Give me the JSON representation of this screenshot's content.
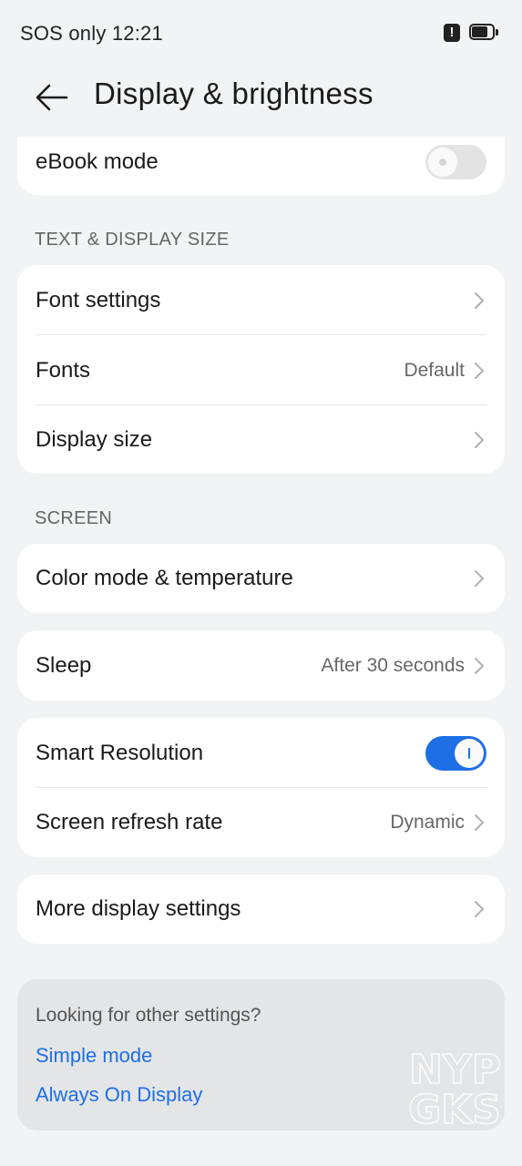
{
  "status_bar": {
    "text": "SOS only 12:21",
    "alert_symbol": "!",
    "icons": [
      "alert-icon",
      "battery-icon"
    ]
  },
  "header": {
    "back_icon": "arrow-left-icon",
    "title": "Display & brightness"
  },
  "top_card": {
    "ebook_label": "eBook mode",
    "ebook_toggle_on": false
  },
  "text_display_section": {
    "title": "TEXT & DISPLAY SIZE",
    "items": [
      {
        "label": "Font settings",
        "value": ""
      },
      {
        "label": "Fonts",
        "value": "Default"
      },
      {
        "label": "Display size",
        "value": ""
      }
    ]
  },
  "screen_section": {
    "title": "SCREEN",
    "color_mode_label": "Color mode & temperature",
    "sleep_label": "Sleep",
    "sleep_value": "After 30 seconds",
    "smart_resolution_label": "Smart Resolution",
    "smart_resolution_on": true,
    "refresh_label": "Screen refresh rate",
    "refresh_value": "Dynamic",
    "more_label": "More display settings"
  },
  "suggestions": {
    "title": "Looking for other settings?",
    "links": [
      "Simple mode",
      "Always On Display"
    ],
    "watermark": [
      "NYP",
      "GKS"
    ]
  },
  "colors": {
    "background": "#f1f3f5",
    "card": "#ffffff",
    "accent": "#1e6fe6",
    "secondary_text": "#666666",
    "suggestion_card": "#e4e5e7"
  }
}
